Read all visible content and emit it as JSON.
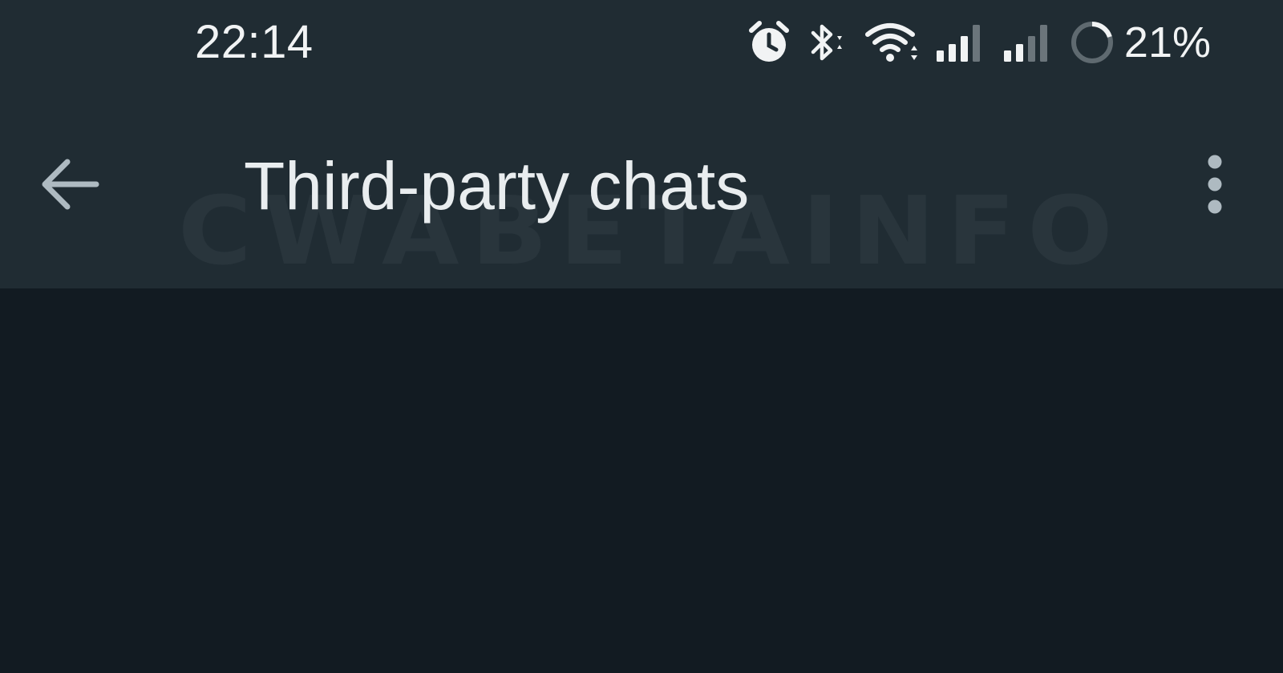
{
  "status_bar": {
    "time": "22:14",
    "battery": "21%",
    "icons": [
      "alarm-icon",
      "bluetooth-icon",
      "wifi-icon",
      "signal-icon",
      "signal-icon",
      "battery-icon"
    ]
  },
  "toolbar": {
    "title": "Third-party chats",
    "watermark": "CWABETAINFO",
    "back_icon": "arrow-left-icon",
    "menu_icon": "more-vertical-icon"
  },
  "colors": {
    "toolbar_bg": "#202c33",
    "content_bg": "#121b22",
    "title_text": "#e9edef",
    "icon_color": "#aebac1"
  }
}
